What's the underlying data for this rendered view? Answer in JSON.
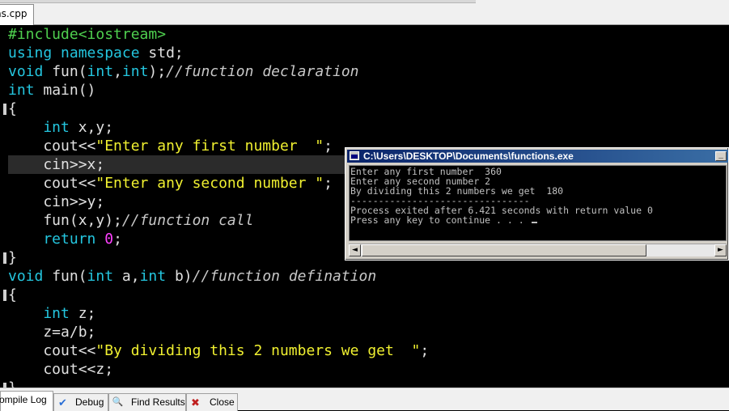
{
  "editor_tab": {
    "filename": "ns.cpp"
  },
  "code_lines": [
    [
      {
        "t": "#include<iostream>",
        "c": "pp"
      }
    ],
    [
      {
        "t": "using namespace ",
        "c": "kw"
      },
      {
        "t": "std;",
        "c": "sym"
      }
    ],
    [
      {
        "t": "void ",
        "c": "kw"
      },
      {
        "t": "fun(",
        "c": "sym"
      },
      {
        "t": "int",
        "c": "kw"
      },
      {
        "t": ",",
        "c": "sym"
      },
      {
        "t": "int",
        "c": "kw"
      },
      {
        "t": ");",
        "c": "sym"
      },
      {
        "t": "//function declaration",
        "c": "cmt"
      }
    ],
    [
      {
        "t": "int ",
        "c": "kw"
      },
      {
        "t": "main()",
        "c": "sym"
      }
    ],
    [
      {
        "t": "{",
        "c": "sym"
      }
    ],
    [
      {
        "t": "    int ",
        "c": "kw"
      },
      {
        "t": "x,y;",
        "c": "sym"
      }
    ],
    [
      {
        "t": "    cout<<",
        "c": "sym"
      },
      {
        "t": "\"Enter any first number  \"",
        "c": "str"
      },
      {
        "t": ";",
        "c": "sym"
      }
    ],
    [
      {
        "t": "    cin>>x;",
        "c": "sym"
      }
    ],
    [
      {
        "t": "    cout<<",
        "c": "sym"
      },
      {
        "t": "\"Enter any second number \"",
        "c": "str"
      },
      {
        "t": ";",
        "c": "sym"
      }
    ],
    [
      {
        "t": "    cin>>y;",
        "c": "sym"
      }
    ],
    [
      {
        "t": "    fun(x,y);",
        "c": "sym"
      },
      {
        "t": "//function call",
        "c": "cmt"
      }
    ],
    [
      {
        "t": "    return ",
        "c": "kw"
      },
      {
        "t": "0",
        "c": "num"
      },
      {
        "t": ";",
        "c": "sym"
      }
    ],
    [
      {
        "t": "}",
        "c": "sym"
      }
    ],
    [
      {
        "t": "void ",
        "c": "kw"
      },
      {
        "t": "fun(",
        "c": "sym"
      },
      {
        "t": "int ",
        "c": "kw"
      },
      {
        "t": "a,",
        "c": "sym"
      },
      {
        "t": "int ",
        "c": "kw"
      },
      {
        "t": "b)",
        "c": "sym"
      },
      {
        "t": "//function defination",
        "c": "cmt"
      }
    ],
    [
      {
        "t": "{",
        "c": "sym"
      }
    ],
    [
      {
        "t": "    int ",
        "c": "kw"
      },
      {
        "t": "z;",
        "c": "sym"
      }
    ],
    [
      {
        "t": "    z=a/b;",
        "c": "sym"
      }
    ],
    [
      {
        "t": "    cout<<",
        "c": "sym"
      },
      {
        "t": "\"By dividing this 2 numbers we get  \"",
        "c": "str"
      },
      {
        "t": ";",
        "c": "sym"
      }
    ],
    [
      {
        "t": "    cout<<z;",
        "c": "sym"
      }
    ],
    [
      {
        "t": "}",
        "c": "sym"
      }
    ]
  ],
  "highlighted_line": 8,
  "console": {
    "title": "C:\\Users\\DESKTOP\\Documents\\functions.exe",
    "minimize_label": "_",
    "lines": [
      "Enter any first number  360",
      "Enter any second number 2",
      "By dividing this 2 numbers we get  180",
      "--------------------------------",
      "Process exited after 6.421 seconds with return value 0",
      "Press any key to continue . . . "
    ],
    "scroll_left": "◄",
    "scroll_right": "►"
  },
  "bottom_tabs": [
    {
      "label": "ompile Log",
      "icon": "compile-log-icon",
      "glyph": "",
      "active": true
    },
    {
      "label": "Debug",
      "icon": "debug-check-icon",
      "glyph": "✔",
      "active": false
    },
    {
      "label": "Find Results",
      "icon": "find-results-icon",
      "glyph": "🔍",
      "active": false
    },
    {
      "label": "Close",
      "icon": "close-icon",
      "glyph": "✖",
      "active": false
    }
  ],
  "colors": {
    "keyword": "#24c6df",
    "preprocessor": "#4fcf4f",
    "string": "#f0f030",
    "comment": "#c8c8c8",
    "number": "#ff40ff",
    "background": "#000000",
    "console_title": "#0a246a"
  }
}
